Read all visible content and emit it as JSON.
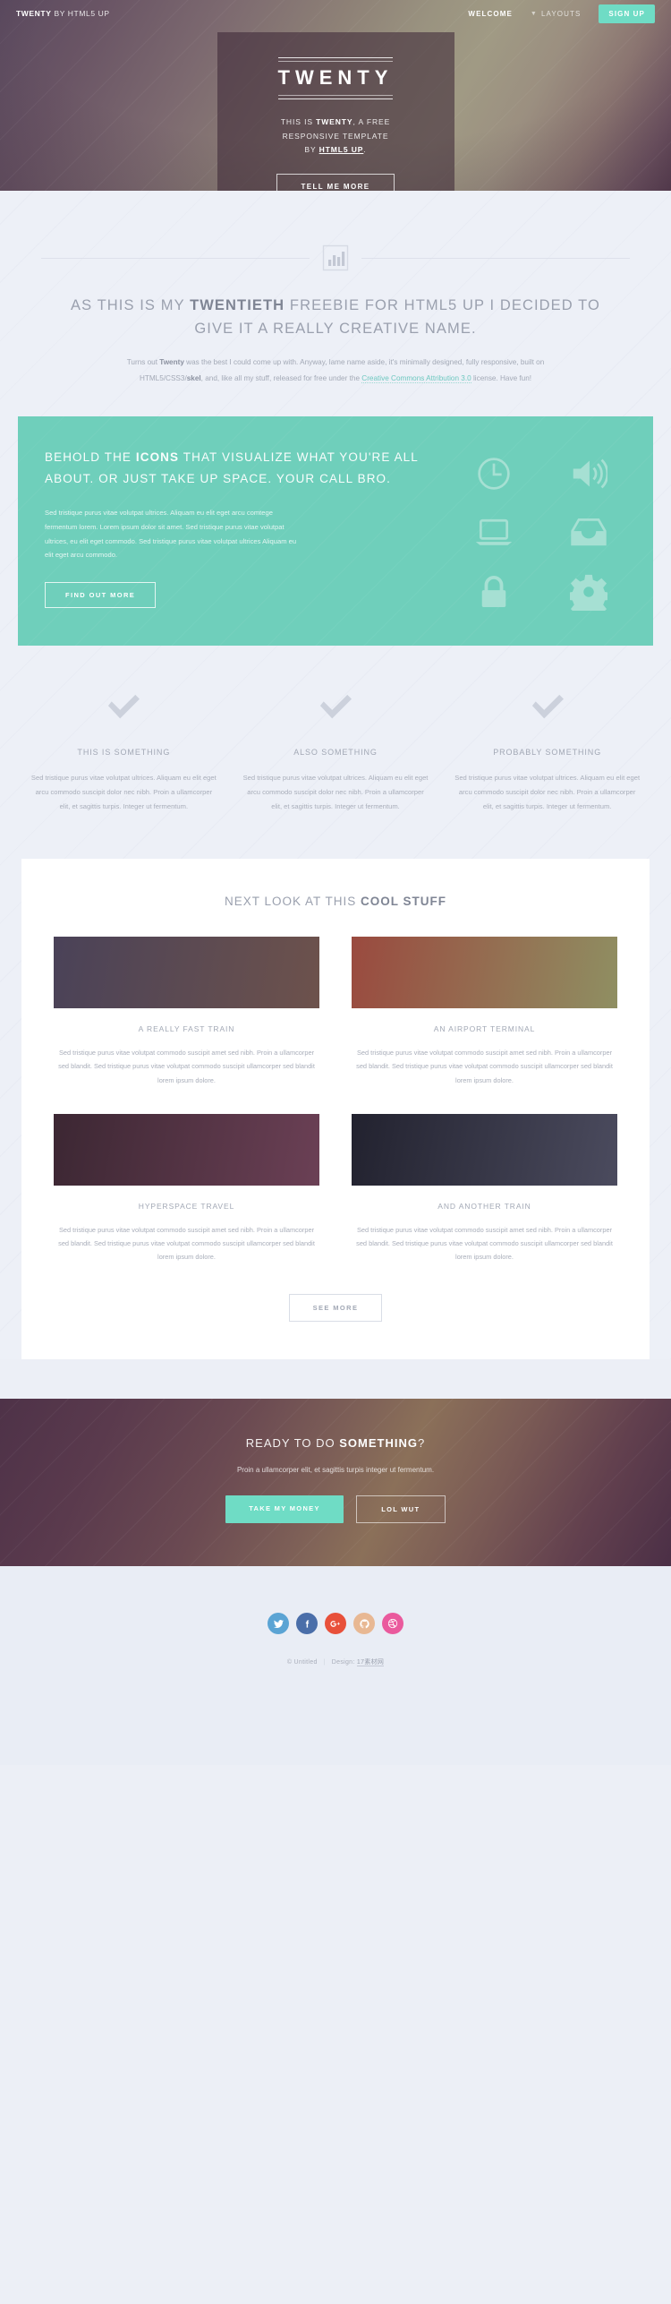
{
  "header": {
    "logo_bold": "TWENTY",
    "logo_rest": " BY HTML5 UP",
    "nav": [
      {
        "label": "Welcome",
        "style": "strong"
      },
      {
        "label": "Layouts",
        "style": "dim",
        "icon": "chevron-down-icon"
      }
    ],
    "signup_label": "Sign Up"
  },
  "banner": {
    "title": "TWENTY",
    "line1_pre": "THIS IS ",
    "line1_bold": "TWENTY",
    "line1_post": ", A FREE",
    "line2": "RESPONSIVE TEMPLATE",
    "line3_pre": "BY ",
    "line3_link": "HTML5 UP",
    "line3_post": ".",
    "cta_label": "Tell Me More"
  },
  "intro": {
    "icon": "bar-chart-icon",
    "headline_pre": "As this is my ",
    "headline_bold": "twentieth",
    "headline_post": " freebie for HTML5 UP I decided to give it a really creative name.",
    "copy_1": "Turns out ",
    "copy_bold_1": "Twenty",
    "copy_2": " was the best I could come up with. Anyway, lame name aside, it's minimally designed, fully responsive, built on HTML5/CSS3/",
    "copy_bold_2": "skel",
    "copy_3": ", and, like all my stuff, released for free under the ",
    "copy_link": "Creative Commons Attribution 3.0",
    "copy_4": " license. Have fun!"
  },
  "teal": {
    "heading_pre": "Behold the ",
    "heading_bold": "icons",
    "heading_post": " that visualize what you're all about. Or just take up space. Your call bro.",
    "body": "Sed tristique purus vitae volutpat ultrices. Aliquam eu elit eget arcu comtege fermentum lorem. Lorem ipsum dolor sit amet. Sed tristique purus vitae volutpat ultrices, eu elit eget commodo. Sed tristique purus vitae volutpat ultrices Aliquam eu elit eget arcu commodo.",
    "cta_label": "Find Out More",
    "icons": [
      "clock-icon",
      "volume-icon",
      "laptop-icon",
      "inbox-icon",
      "lock-icon",
      "gear-icon"
    ],
    "accent_color": "#6fcfbb"
  },
  "features": {
    "icon": "check-icon",
    "items": [
      {
        "title": "This Is Something",
        "body": "Sed tristique purus vitae volutpat ultrices. Aliquam eu elit eget arcu commodo suscipit dolor nec nibh. Proin a ullamcorper elit, et sagittis turpis. Integer ut fermentum."
      },
      {
        "title": "Also Something",
        "body": "Sed tristique purus vitae volutpat ultrices. Aliquam eu elit eget arcu commodo suscipit dolor nec nibh. Proin a ullamcorper elit, et sagittis turpis. Integer ut fermentum."
      },
      {
        "title": "Probably Something",
        "body": "Sed tristique purus vitae volutpat ultrices. Aliquam eu elit eget arcu commodo suscipit dolor nec nibh. Proin a ullamcorper elit, et sagittis turpis. Integer ut fermentum."
      }
    ]
  },
  "cool_stuff": {
    "heading_pre": "Next look at this ",
    "heading_bold": "cool stuff",
    "tiles": [
      {
        "title": "A Really Fast Train",
        "body": "Sed tristique purus vitae volutpat commodo suscipit amet sed nibh. Proin a ullamcorper sed blandit. Sed tristique purus vitae volutpat commodo suscipit ullamcorper sed blandit lorem ipsum dolore.",
        "thumb_from": "#4a4258",
        "thumb_to": "#6d524c"
      },
      {
        "title": "An Airport Terminal",
        "body": "Sed tristique purus vitae volutpat commodo suscipit amet sed nibh. Proin a ullamcorper sed blandit. Sed tristique purus vitae volutpat commodo suscipit ullamcorper sed blandit lorem ipsum dolore.",
        "thumb_from": "#9a4a3f",
        "thumb_to": "#8f8f62"
      },
      {
        "title": "Hyperspace Travel",
        "body": "Sed tristique purus vitae volutpat commodo suscipit amet sed nibh. Proin a ullamcorper sed blandit. Sed tristique purus vitae volutpat commodo suscipit ullamcorper sed blandit lorem ipsum dolore.",
        "thumb_from": "#3c2733",
        "thumb_to": "#6b4055"
      },
      {
        "title": "And Another Train",
        "body": "Sed tristique purus vitae volutpat commodo suscipit amet sed nibh. Proin a ullamcorper sed blandit. Sed tristique purus vitae volutpat commodo suscipit ullamcorper sed blandit lorem ipsum dolore.",
        "thumb_from": "#22222f",
        "thumb_to": "#4b4b5e"
      }
    ],
    "see_more_label": "See More"
  },
  "cta": {
    "heading_pre": "Ready to do ",
    "heading_bold": "something",
    "heading_post": "?",
    "subtext": "Proin a ullamcorper elit, et sagittis turpis integer ut fermentum.",
    "primary_label": "Take My Money",
    "secondary_label": "Lol Wut"
  },
  "footer": {
    "social": [
      {
        "name": "twitter-icon",
        "color": "#5ba4d4",
        "glyph": "twitter"
      },
      {
        "name": "facebook-icon",
        "color": "#4a6ea9",
        "glyph": "facebook"
      },
      {
        "name": "google-plus-icon",
        "color": "#e8503a",
        "glyph": "google-plus"
      },
      {
        "name": "github-icon",
        "color": "#e8b893",
        "glyph": "github"
      },
      {
        "name": "dribbble-icon",
        "color": "#ea5a9d",
        "glyph": "dribbble"
      }
    ],
    "copyright": "© Untitled",
    "design_label": "Design: ",
    "design_link": "17素材网"
  }
}
